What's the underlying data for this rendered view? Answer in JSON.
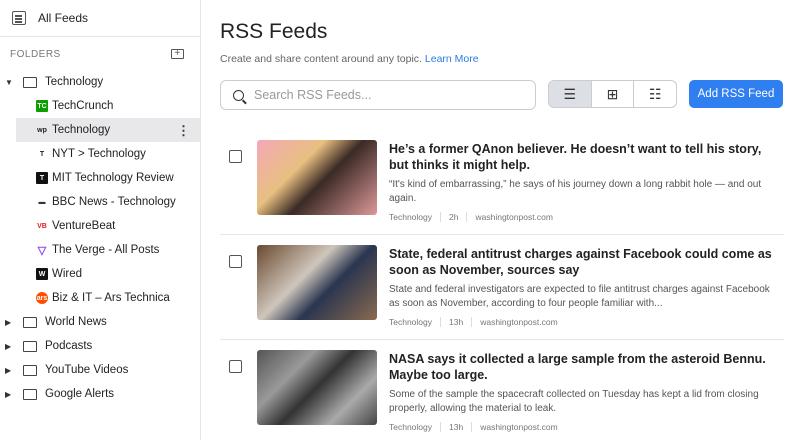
{
  "sidebar": {
    "all_feeds": "All Feeds",
    "folders_label": "FOLDERS",
    "open_folder": "Technology",
    "feeds": [
      {
        "label": "TechCrunch",
        "icon": "TC",
        "color": "#0a9e01"
      },
      {
        "label": "Technology",
        "icon": "wp",
        "color": "#222222"
      },
      {
        "label": "NYT > Technology",
        "icon": "T",
        "color": "#222222"
      },
      {
        "label": "MIT Technology Review",
        "icon": "T",
        "color": "#111111"
      },
      {
        "label": "BBC News - Technology",
        "icon": "BBC",
        "color": "#333333"
      },
      {
        "label": "VentureBeat",
        "icon": "VB",
        "color": "#e01b22"
      },
      {
        "label": "The Verge - All Posts",
        "icon": "▽",
        "color": "#8e44ec"
      },
      {
        "label": "Wired",
        "icon": "W",
        "color": "#111111"
      },
      {
        "label": "Biz & IT – Ars Technica",
        "icon": "ars",
        "color": "#ff4e00"
      }
    ],
    "folders": [
      "World News",
      "Podcasts",
      "YouTube Videos",
      "Google Alerts"
    ]
  },
  "main": {
    "title": "RSS Feeds",
    "subtitle": "Create and share content around any topic.",
    "learn_more": "Learn More",
    "search_placeholder": "Search RSS Feeds...",
    "add_button": "Add RSS Feed",
    "articles": [
      {
        "title": "He’s a former QAnon believer. He doesn’t want to tell his story, but thinks it might help.",
        "desc": "“It's kind of embarrassing,” he says of his journey down a long rabbit hole — and out again.",
        "category": "Technology",
        "age": "2h",
        "source": "washingtonpost.com"
      },
      {
        "title": "State, federal antitrust charges against Facebook could come as soon as November, sources say",
        "desc": "State and federal investigators are expected to file antitrust charges against Facebook as soon as November, according to four people familiar with...",
        "category": "Technology",
        "age": "13h",
        "source": "washingtonpost.com"
      },
      {
        "title": "NASA says it collected a large sample from the asteroid Bennu. Maybe too large.",
        "desc": "Some of the sample the spacecraft collected on Tuesday has kept a lid from closing properly, allowing the material to leak.",
        "category": "Technology",
        "age": "13h",
        "source": "washingtonpost.com"
      }
    ]
  }
}
